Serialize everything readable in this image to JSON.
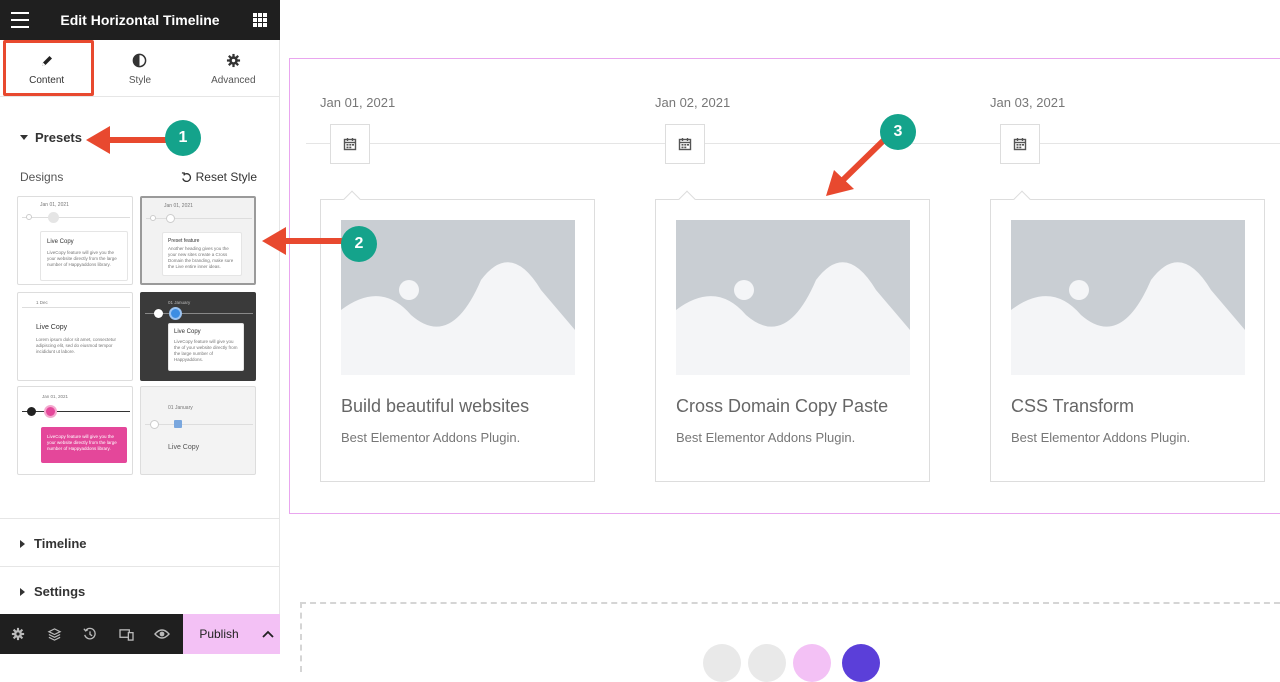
{
  "sidebar": {
    "title": "Edit Horizontal Timeline",
    "tabs": [
      {
        "label": "Content",
        "icon": "pencil-icon",
        "active": true
      },
      {
        "label": "Style",
        "icon": "half-circle-icon",
        "active": false
      },
      {
        "label": "Advanced",
        "icon": "gear-icon",
        "active": false
      }
    ],
    "presets": {
      "label": "Presets",
      "designs_label": "Designs",
      "reset_label": "Reset Style",
      "thumbnails": [
        {
          "date": "Jan 01, 2021",
          "title": "Live Copy",
          "text": "LiveCopy feature will give you the your website directly from the large number of Happyaddons library."
        },
        {
          "date": "Jan 01, 2021",
          "title": "Preset feature",
          "text": "Another heading gives you the your new sites create a Cross Domain the branding, make sure the Live entire inner ideas."
        },
        {
          "date": "1 Dec",
          "title": "Live Copy",
          "text": "Lorem ipsum dolor sit amet, consectetur adipiscing elit, sed do eiusmod tempor incididunt ut labore."
        },
        {
          "date": "01 January",
          "title": "Live Copy",
          "text": "LiveCopy feature will give you the of your website directly from the large number of Happyaddons."
        },
        {
          "date": "Jan 01, 2021",
          "title": "",
          "text": "LiveCopy feature will give you the your website directly from the large number of Happyaddons library."
        },
        {
          "date": "01 January",
          "title": "Live Copy",
          "text": ""
        }
      ]
    },
    "sections": [
      {
        "label": "Timeline"
      },
      {
        "label": "Settings"
      }
    ],
    "footer": {
      "icons": [
        "gear-icon",
        "layers-icon",
        "history-icon",
        "responsive-icon",
        "eye-icon"
      ],
      "publish_label": "Publish"
    }
  },
  "timeline": {
    "items": [
      {
        "date": "Jan 01, 2021",
        "title": "Build beautiful websites",
        "subtitle": "Best Elementor Addons Plugin."
      },
      {
        "date": "Jan 02, 2021",
        "title": "Cross Domain Copy Paste",
        "subtitle": "Best Elementor Addons Plugin."
      },
      {
        "date": "Jan 03, 2021",
        "title": "CSS Transform",
        "subtitle": "Best Elementor Addons Plugin."
      }
    ]
  },
  "annotations": [
    {
      "number": "1"
    },
    {
      "number": "2"
    },
    {
      "number": "3"
    }
  ],
  "colors": {
    "annotation_badge": "#14a38b",
    "annotation_arrow": "#e8492f",
    "publish_bg": "#f3c1f5",
    "timeline_border": "#e9a6ef"
  }
}
